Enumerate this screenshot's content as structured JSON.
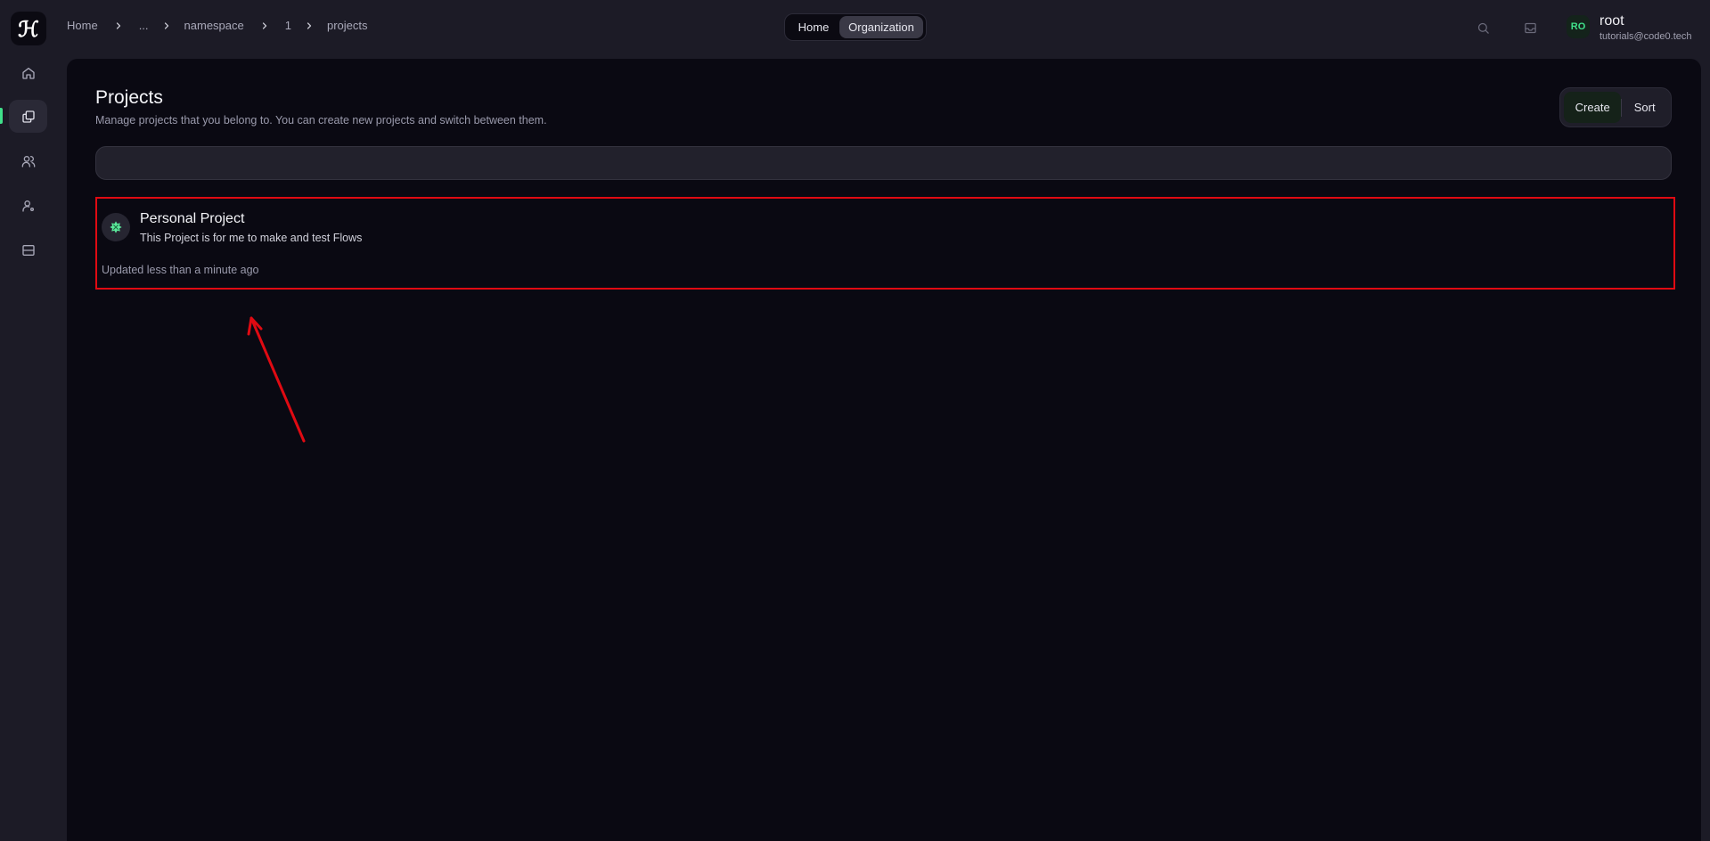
{
  "sidebar": {
    "logo_glyph": "ℋ",
    "items": [
      {
        "name": "home",
        "icon": "home-icon"
      },
      {
        "name": "projects",
        "icon": "folders-icon",
        "active": true
      },
      {
        "name": "members",
        "icon": "users-icon"
      },
      {
        "name": "roles",
        "icon": "user-settings-icon"
      },
      {
        "name": "storage",
        "icon": "server-icon"
      }
    ]
  },
  "breadcrumb": [
    "Home",
    "...",
    "namespace",
    "1",
    "projects"
  ],
  "toggle": {
    "home_label": "Home",
    "org_label": "Organization"
  },
  "user": {
    "initials": "RO",
    "name": "root",
    "email": "tutorials@code0.tech"
  },
  "page": {
    "title": "Projects",
    "subtitle": "Manage projects that you belong to. You can create new projects and switch between them.",
    "create_label": "Create",
    "sort_label": "Sort",
    "search_value": ""
  },
  "projects": [
    {
      "name": "Personal Project",
      "description": "This Project is for me to make and test Flows",
      "updated": "Updated less than a minute ago"
    }
  ],
  "colors": {
    "accent": "#40e08a",
    "highlight": "#e00a12",
    "background": "#0a0912"
  }
}
